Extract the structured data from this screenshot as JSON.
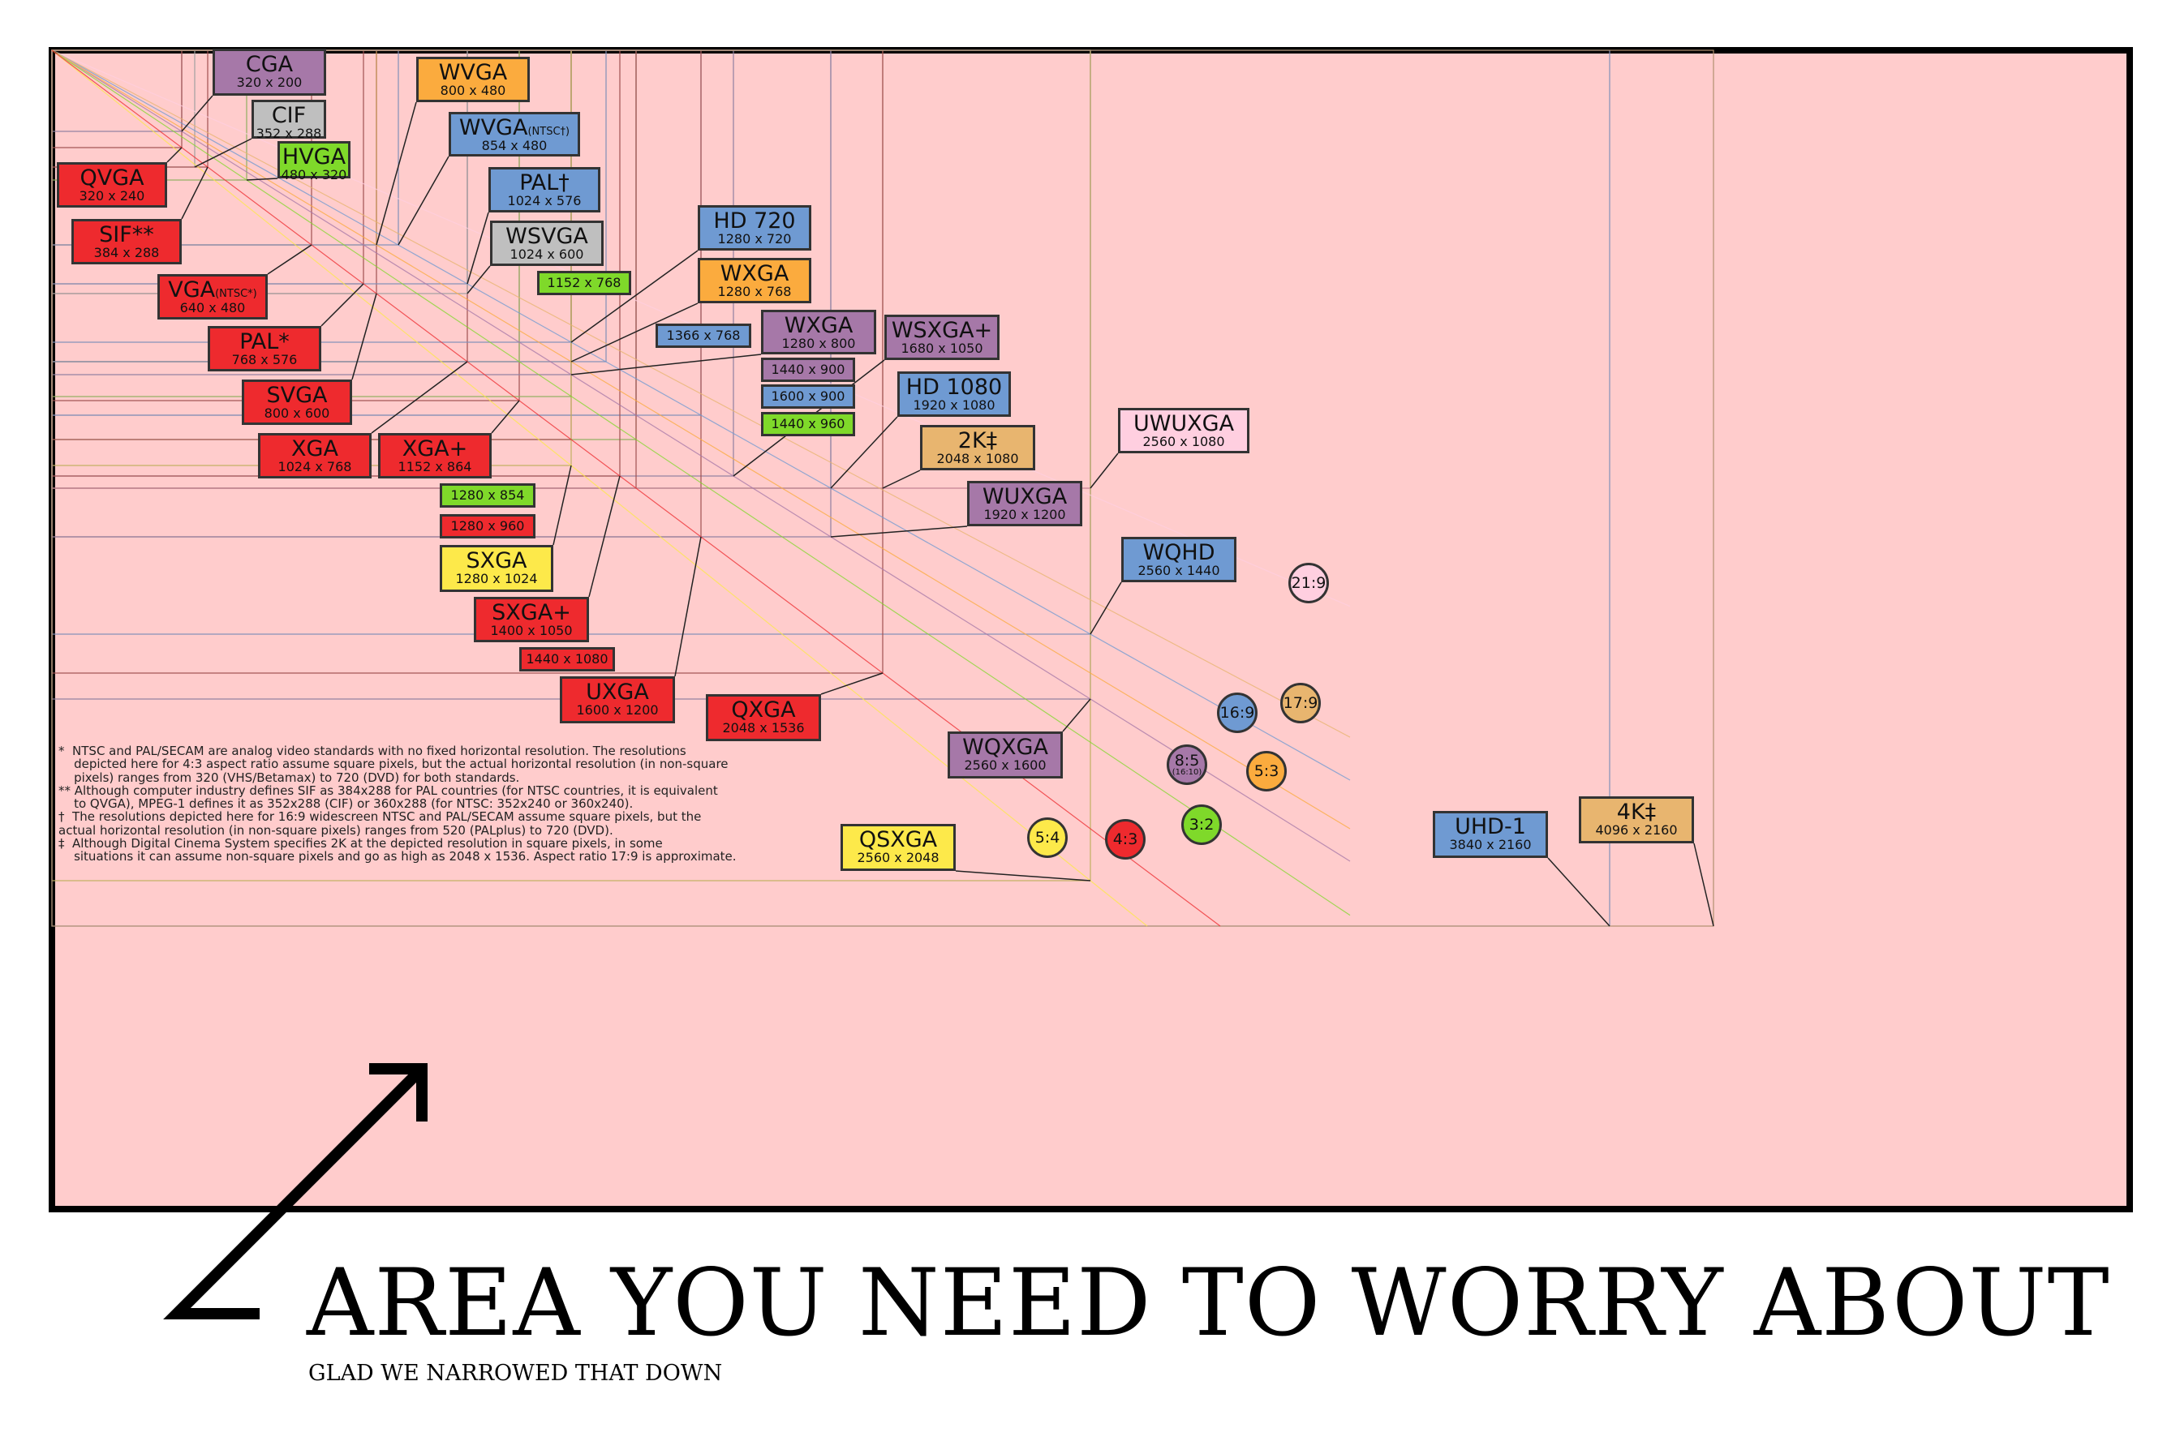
{
  "colors": {
    "background": "#ffcccc",
    "red": "#ee2a2e",
    "purple": "#a678a8",
    "orange": "#fbab3e",
    "blue": "#6f9ad2",
    "green": "#7fd92a",
    "gray": "#bfbfbf",
    "yellow": "#fde94a",
    "tan": "#e8b56f",
    "pink": "#ffcfe0"
  },
  "labels": [
    {
      "id": "cga",
      "name": "CGA",
      "res": "320 x 200",
      "color": "purple"
    },
    {
      "id": "wvga",
      "name": "WVGA",
      "res": "800 x 480",
      "color": "orange"
    },
    {
      "id": "cif",
      "name": "CIF",
      "res": "352 x 288",
      "color": "gray"
    },
    {
      "id": "wvga-ntsc",
      "name": "WVGA",
      "suffix": "(NTSC†)",
      "res": "854 x 480",
      "color": "blue"
    },
    {
      "id": "hvga",
      "name": "HVGA",
      "res": "480 x 320",
      "color": "green"
    },
    {
      "id": "qvga",
      "name": "QVGA",
      "res": "320 x 240",
      "color": "red"
    },
    {
      "id": "pal-dagger",
      "name": "PAL†",
      "res": "1024 x 576",
      "color": "blue"
    },
    {
      "id": "sif",
      "name": "SIF**",
      "res": "384 x 288",
      "color": "red"
    },
    {
      "id": "hd720",
      "name": "HD 720",
      "res": "1280 x 720",
      "color": "blue"
    },
    {
      "id": "wsvga",
      "name": "WSVGA",
      "res": "1024 x 600",
      "color": "gray"
    },
    {
      "id": "wxga-768",
      "name": "WXGA",
      "res": "1280 x 768",
      "color": "orange"
    },
    {
      "id": "vga-ntsc",
      "name": "VGA",
      "suffix": "(NTSC*)",
      "res": "640 x 480",
      "color": "red"
    },
    {
      "id": "wxga-800",
      "name": "WXGA",
      "res": "1280 x 800",
      "color": "purple"
    },
    {
      "id": "wsxga-plus",
      "name": "WSXGA+",
      "res": "1680 x 1050",
      "color": "purple"
    },
    {
      "id": "pal-star",
      "name": "PAL*",
      "res": "768 x 576",
      "color": "red"
    },
    {
      "id": "hd1080",
      "name": "HD 1080",
      "res": "1920 x 1080",
      "color": "blue"
    },
    {
      "id": "svga",
      "name": "SVGA",
      "res": "800 x 600",
      "color": "red"
    },
    {
      "id": "uwuxga",
      "name": "UWUXGA",
      "res": "2560 x 1080",
      "color": "pink"
    },
    {
      "id": "2k",
      "name": "2K‡",
      "res": "2048 x 1080",
      "color": "tan"
    },
    {
      "id": "xga",
      "name": "XGA",
      "res": "1024 x 768",
      "color": "red"
    },
    {
      "id": "xga-plus",
      "name": "XGA+",
      "res": "1152 x 864",
      "color": "red"
    },
    {
      "id": "wuxga",
      "name": "WUXGA",
      "res": "1920 x 1200",
      "color": "purple"
    },
    {
      "id": "sxga",
      "name": "SXGA",
      "res": "1280 x 1024",
      "color": "yellow"
    },
    {
      "id": "wqhd",
      "name": "WQHD",
      "res": "2560 x 1440",
      "color": "blue"
    },
    {
      "id": "sxga-plus",
      "name": "SXGA+",
      "res": "1400 x 1050",
      "color": "red"
    },
    {
      "id": "uxga",
      "name": "UXGA",
      "res": "1600 x 1200",
      "color": "red"
    },
    {
      "id": "qxga",
      "name": "QXGA",
      "res": "2048 x 1536",
      "color": "red"
    },
    {
      "id": "wqxga",
      "name": "WQXGA",
      "res": "2560 x 1600",
      "color": "purple"
    },
    {
      "id": "qsxga",
      "name": "QSXGA",
      "res": "2560 x 2048",
      "color": "yellow"
    },
    {
      "id": "uhd1",
      "name": "UHD-1",
      "res": "3840 x 2160",
      "color": "blue"
    },
    {
      "id": "4k",
      "name": "4K‡",
      "res": "4096 x 2160",
      "color": "tan"
    }
  ],
  "mini_labels": [
    {
      "id": "1152x768",
      "text": "1152 x 768",
      "color": "green"
    },
    {
      "id": "1366x768",
      "text": "1366 x 768",
      "color": "blue"
    },
    {
      "id": "1440x900",
      "text": "1440 x 900",
      "color": "purple"
    },
    {
      "id": "1600x900",
      "text": "1600 x 900",
      "color": "blue"
    },
    {
      "id": "1440x960",
      "text": "1440 x 960",
      "color": "green"
    },
    {
      "id": "1280x854",
      "text": "1280 x 854",
      "color": "green"
    },
    {
      "id": "1280x960",
      "text": "1280 x 960",
      "color": "red"
    },
    {
      "id": "1440x1080",
      "text": "1440 x 1080",
      "color": "red"
    }
  ],
  "ratios": [
    {
      "id": "21-9",
      "text": "21:9",
      "color": "pink"
    },
    {
      "id": "17-9",
      "text": "17:9",
      "color": "tan"
    },
    {
      "id": "16-9",
      "text": "16:9",
      "color": "blue"
    },
    {
      "id": "8-5",
      "text": "8:5",
      "sub": "(16:10)",
      "color": "purple"
    },
    {
      "id": "5-3",
      "text": "5:3",
      "color": "orange"
    },
    {
      "id": "3-2",
      "text": "3:2",
      "color": "green"
    },
    {
      "id": "5-4",
      "text": "5:4",
      "color": "yellow"
    },
    {
      "id": "4-3",
      "text": "4:3",
      "color": "red"
    }
  ],
  "notes": [
    "*  NTSC and PAL/SECAM are analog video standards with no fixed horizontal resolution. The resolutions",
    "    depicted here for 4:3 aspect ratio assume square pixels, but the actual horizontal resolution (in non-square",
    "    pixels) ranges from 320 (VHS/Betamax) to 720 (DVD) for both standards.",
    "** Although computer industry defines SIF as 384x288 for PAL countries (for NTSC countries, it is equivalent",
    "    to QVGA), MPEG-1 defines it as 352x288 (CIF) or 360x288 (for NTSC: 352x240 or 360x240).",
    "†  The resolutions depicted here for 16:9 widescreen NTSC and PAL/SECAM assume square pixels, but the",
    "actual horizontal resolution (in non-square pixels) ranges from 520 (PALplus) to 720 (DVD).",
    "‡  Although Digital Cinema System specifies 2K at the depicted resolution in square pixels, in some",
    "    situations it can assume non-square pixels and go as high as 2048 x 1536. Aspect ratio 17:9 is approximate."
  ],
  "caption": "AREA YOU NEED TO WORRY ABOUT",
  "subcaption": "GLAD WE NARROWED THAT DOWN"
}
